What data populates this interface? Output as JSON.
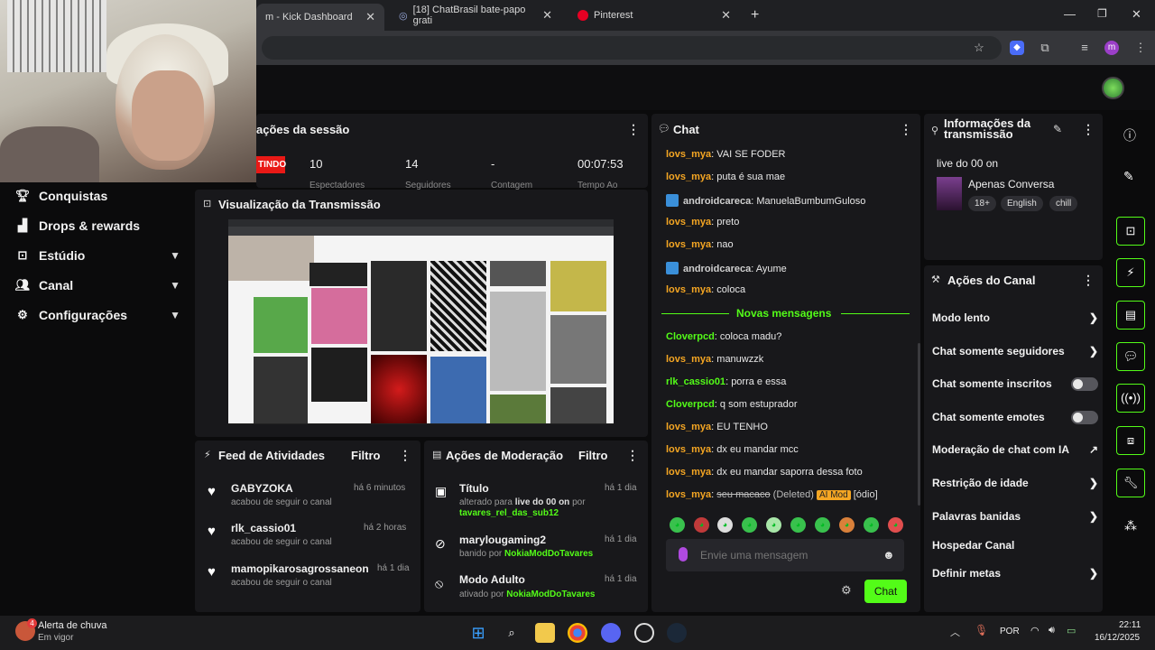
{
  "browser": {
    "tabs": [
      {
        "title": "m - Kick Dashboard",
        "active": true
      },
      {
        "title": "[18] ChatBrasil bate-papo grati",
        "active": false
      },
      {
        "title": "Pinterest",
        "active": false
      }
    ],
    "new_tab": "+",
    "profile_initial": "m"
  },
  "sidebar": {
    "items": [
      {
        "label": "Conquistas",
        "icon": "trophy-icon",
        "has_chevron": false
      },
      {
        "label": "Drops & rewards",
        "icon": "drops-icon",
        "has_chevron": false
      },
      {
        "label": "Estúdio",
        "icon": "studio-icon",
        "has_chevron": true
      },
      {
        "label": "Canal",
        "icon": "channel-icon",
        "has_chevron": true
      },
      {
        "label": "Configurações",
        "icon": "gear-icon",
        "has_chevron": true
      }
    ]
  },
  "session": {
    "title": "ações da sessão",
    "live_badge": "TINDO",
    "stats": [
      {
        "value": "10",
        "label": "Espectadores"
      },
      {
        "value": "14",
        "label": "Seguidores"
      },
      {
        "value": "-",
        "label": "Contagem"
      },
      {
        "value": "00:07:53",
        "label": "Tempo Ao"
      }
    ]
  },
  "preview": {
    "title": "Visualização da Transmissão"
  },
  "activity": {
    "title": "Feed de Atividades",
    "filter": "Filtro",
    "items": [
      {
        "name": "GABYZOKA",
        "time": "há 6 minutos",
        "sub": "acabou de seguir o canal"
      },
      {
        "name": "rlk_cassio01",
        "time": "há 2 horas",
        "sub": "acabou de seguir o canal"
      },
      {
        "name": "mamopikarosagrossaneon",
        "time": "há 1 dia",
        "sub": "acabou de seguir o canal"
      }
    ]
  },
  "moderation": {
    "title": "Ações de Moderação",
    "filter": "Filtro",
    "items": [
      {
        "name": "Título",
        "time": "há 1 dia",
        "sub_prefix": "alterado para ",
        "sub_bold": "live do 00 on",
        "sub_mid": " por",
        "sub_user": "tavares_rel_das_sub12"
      },
      {
        "name": "marylougaming2",
        "time": "há 1 dia",
        "sub_prefix": "banido por ",
        "sub_user": "NokiaModDoTavares"
      },
      {
        "name": "Modo Adulto",
        "time": "há 1 dia",
        "sub_prefix": "ativado por ",
        "sub_user": "NokiaModDoTavares"
      }
    ]
  },
  "chat": {
    "title": "Chat",
    "messages_top": [
      {
        "user": "lovs_mya",
        "color": "#f5a623",
        "text": "VAI SE FODER"
      },
      {
        "user": "lovs_mya",
        "color": "#f5a623",
        "text": "puta é sua mae"
      },
      {
        "user": "androidcareca",
        "color": "#cfcfcf",
        "text": "ManuelaBumbumGuloso",
        "badge": true
      },
      {
        "user": "lovs_mya",
        "color": "#f5a623",
        "text": "preto"
      },
      {
        "user": "lovs_mya",
        "color": "#f5a623",
        "text": "nao"
      },
      {
        "user": "androidcareca",
        "color": "#cfcfcf",
        "text": "Ayume",
        "badge": true
      },
      {
        "user": "lovs_mya",
        "color": "#f5a623",
        "text": "coloca"
      }
    ],
    "new_messages": "Novas mensagens",
    "messages_bottom": [
      {
        "user": "Cloverpcd",
        "color": "#53fc18",
        "text": "coloca madu?"
      },
      {
        "user": "lovs_mya",
        "color": "#f5a623",
        "text": "manuwzzk"
      },
      {
        "user": "rlk_cassio01",
        "color": "#53fc18",
        "text": "porra e essa"
      },
      {
        "user": "Cloverpcd",
        "color": "#53fc18",
        "text": "q som estuprador"
      },
      {
        "user": "lovs_mya",
        "color": "#f5a623",
        "text": "EU TENHO"
      },
      {
        "user": "lovs_mya",
        "color": "#f5a623",
        "text": "dx eu mandar mcc"
      },
      {
        "user": "lovs_mya",
        "color": "#f5a623",
        "text": "dx eu mandar saporra dessa foto"
      }
    ],
    "deleted": {
      "user": "lovs_mya",
      "text": "seu macaco",
      "deleted_label": "(Deleted)",
      "ai_badge": "AI Mod",
      "reason": "[ódio]"
    },
    "input_placeholder": "Envie uma mensagem",
    "send_label": "Chat"
  },
  "stream_info": {
    "title": "Informações da transmissão",
    "stream_title": "live do 00 on",
    "category": "Apenas Conversa",
    "tags": [
      "18+",
      "English",
      "chill"
    ]
  },
  "channel_actions": {
    "title": "Ações do Canal",
    "items": [
      {
        "label": "Modo lento",
        "kind": "chevron"
      },
      {
        "label": "Chat somente seguidores",
        "kind": "chevron"
      },
      {
        "label": "Chat somente inscritos",
        "kind": "toggle",
        "on": false
      },
      {
        "label": "Chat somente emotes",
        "kind": "toggle",
        "on": false
      },
      {
        "label": "Moderação de chat com IA",
        "kind": "external"
      },
      {
        "label": "Restrição de idade",
        "kind": "chevron"
      },
      {
        "label": "Palavras banidas",
        "kind": "chevron"
      },
      {
        "label": "Hospedar Canal",
        "kind": "none"
      },
      {
        "label": "Definir metas",
        "kind": "chevron"
      }
    ]
  },
  "taskbar": {
    "weather_title": "Alerta de chuva",
    "weather_sub": "Em vigor",
    "weather_badge": "4",
    "lang": "POR",
    "time": "22:11",
    "date": "16/12/2025"
  },
  "colors": {
    "accent": "#53fc18",
    "panel": "#18181b",
    "live": "#e91916",
    "orange_user": "#f5a623"
  }
}
